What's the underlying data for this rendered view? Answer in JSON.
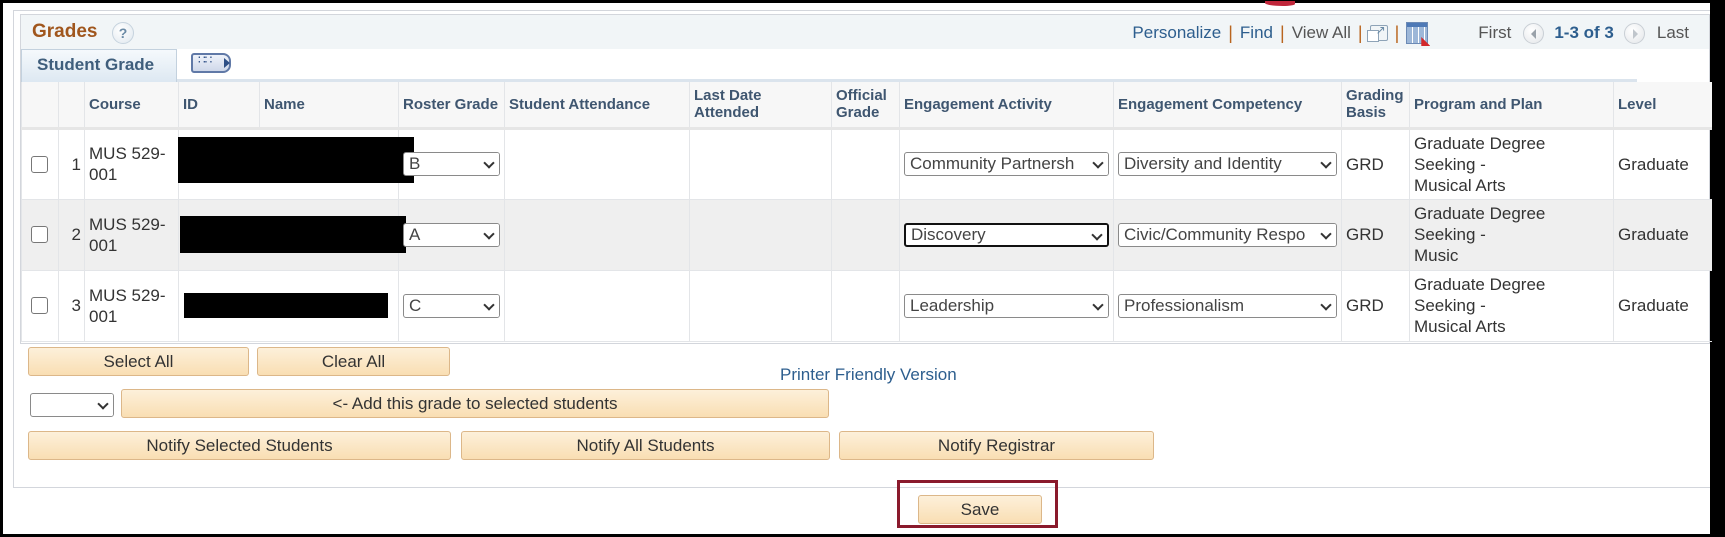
{
  "grid": {
    "title": "Grades",
    "help_icon": "?",
    "nav": {
      "personalize": "Personalize",
      "find": "Find",
      "view_all": "View All",
      "separator": "|",
      "first": "First",
      "range": "1-3 of 3",
      "last": "Last"
    },
    "tab": "Student Grade",
    "columns": [
      "",
      "",
      "Course",
      "ID",
      "Name",
      "Roster Grade",
      "Student Attendance",
      "Last Date Attended",
      "Official Grade",
      "Engagement Activity",
      "Engagement Competency",
      "Grading Basis",
      "Program and Plan",
      "Level"
    ],
    "rows": [
      {
        "num": "1",
        "course_line1": "MUS 529-",
        "course_line2": "001",
        "roster_grade": "B",
        "engagement_activity": "Community Partnersh",
        "engagement_competency": "Diversity and Identity",
        "grading_basis": "GRD",
        "plan_line1": "Graduate Degree",
        "plan_line2": "Seeking -",
        "plan_line3": "Musical Arts",
        "level": "Graduate"
      },
      {
        "num": "2",
        "course_line1": "MUS 529-",
        "course_line2": "001",
        "roster_grade": "A",
        "engagement_activity": "Discovery",
        "engagement_competency": "Civic/Community Respo",
        "grading_basis": "GRD",
        "plan_line1": "Graduate Degree",
        "plan_line2": "Seeking -",
        "plan_line3": "Music",
        "level": "Graduate"
      },
      {
        "num": "3",
        "course_line1": "MUS 529-",
        "course_line2": "001",
        "roster_grade": "C",
        "engagement_activity": "Leadership",
        "engagement_competency": "Professionalism",
        "grading_basis": "GRD",
        "plan_line1": "Graduate Degree",
        "plan_line2": "Seeking -",
        "plan_line3": "Musical Arts",
        "level": "Graduate"
      }
    ]
  },
  "actions": {
    "select_all": "Select All",
    "clear_all": "Clear All",
    "printer_friendly": "Printer Friendly Version",
    "grade_select_value": "",
    "add_grade": "<- Add this grade to selected students",
    "notify_selected": "Notify Selected Students",
    "notify_all": "Notify All Students",
    "notify_registrar": "Notify Registrar",
    "save": "Save"
  }
}
